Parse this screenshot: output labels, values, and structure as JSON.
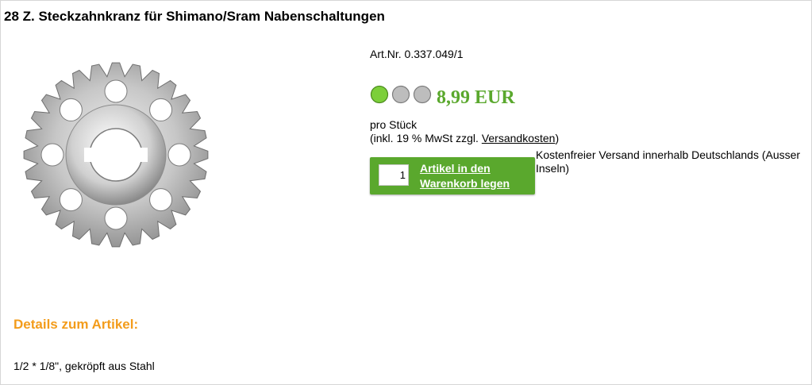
{
  "product": {
    "title": "28 Z. Steckzahnkranz für Shimano/Sram Nabenschaltungen",
    "art_nr": "Art.Nr. 0.337.049/1",
    "availability_lights": [
      "green",
      "gray",
      "gray"
    ],
    "price": "8,99 EUR",
    "unit": "pro Stück",
    "tax_prefix": "(inkl. 19 % MwSt zzgl. ",
    "shipping_link": "Versandkosten",
    "tax_suffix": ")",
    "shipping_info": "Kostenfreier Versand innerhalb Deutschlands (Ausser Inseln)"
  },
  "cart": {
    "quantity": "1",
    "button_label": "Artikel in den Warenkorb legen"
  },
  "details": {
    "heading": "Details zum Artikel:",
    "text": "1/2 * 1/8\", gekröpft aus Stahl"
  },
  "colors": {
    "accent_green": "#5aa82d",
    "details_orange": "#f39c1b"
  }
}
